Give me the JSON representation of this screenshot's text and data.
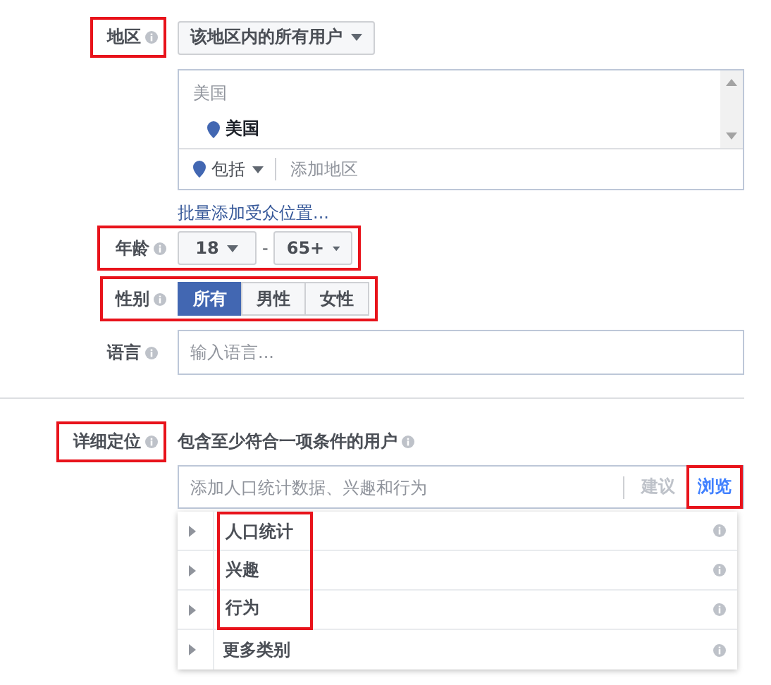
{
  "location": {
    "label": "地区",
    "highlighted": true,
    "scope": "该地区内的所有用户",
    "group": "美国",
    "selected_location": "美国",
    "mode": "包括",
    "placeholder": "添加地区",
    "bulk_link": "批量添加受众位置..."
  },
  "age": {
    "label": "年龄",
    "highlighted": true,
    "min": "18",
    "separator": "-",
    "max": "65+"
  },
  "gender": {
    "label": "性别",
    "highlighted": true,
    "options": [
      {
        "label": "所有",
        "selected": true
      },
      {
        "label": "男性",
        "selected": false
      },
      {
        "label": "女性",
        "selected": false
      }
    ]
  },
  "language": {
    "label": "语言",
    "highlighted": false,
    "placeholder": "输入语言..."
  },
  "detailed_targeting": {
    "label": "详细定位",
    "highlighted": true,
    "description": "包含至少符合一项条件的用户",
    "placeholder": "添加人口统计数据、兴趣和行为",
    "tabs": [
      {
        "label": "建议",
        "selected": false,
        "highlighted": false
      },
      {
        "label": "浏览",
        "selected": true,
        "highlighted": true
      }
    ],
    "categories": [
      {
        "label": "人口统计",
        "highlighted": true
      },
      {
        "label": "兴趣",
        "highlighted": true
      },
      {
        "label": "行为",
        "highlighted": true
      },
      {
        "label": "更多类别",
        "highlighted": false
      }
    ]
  }
}
